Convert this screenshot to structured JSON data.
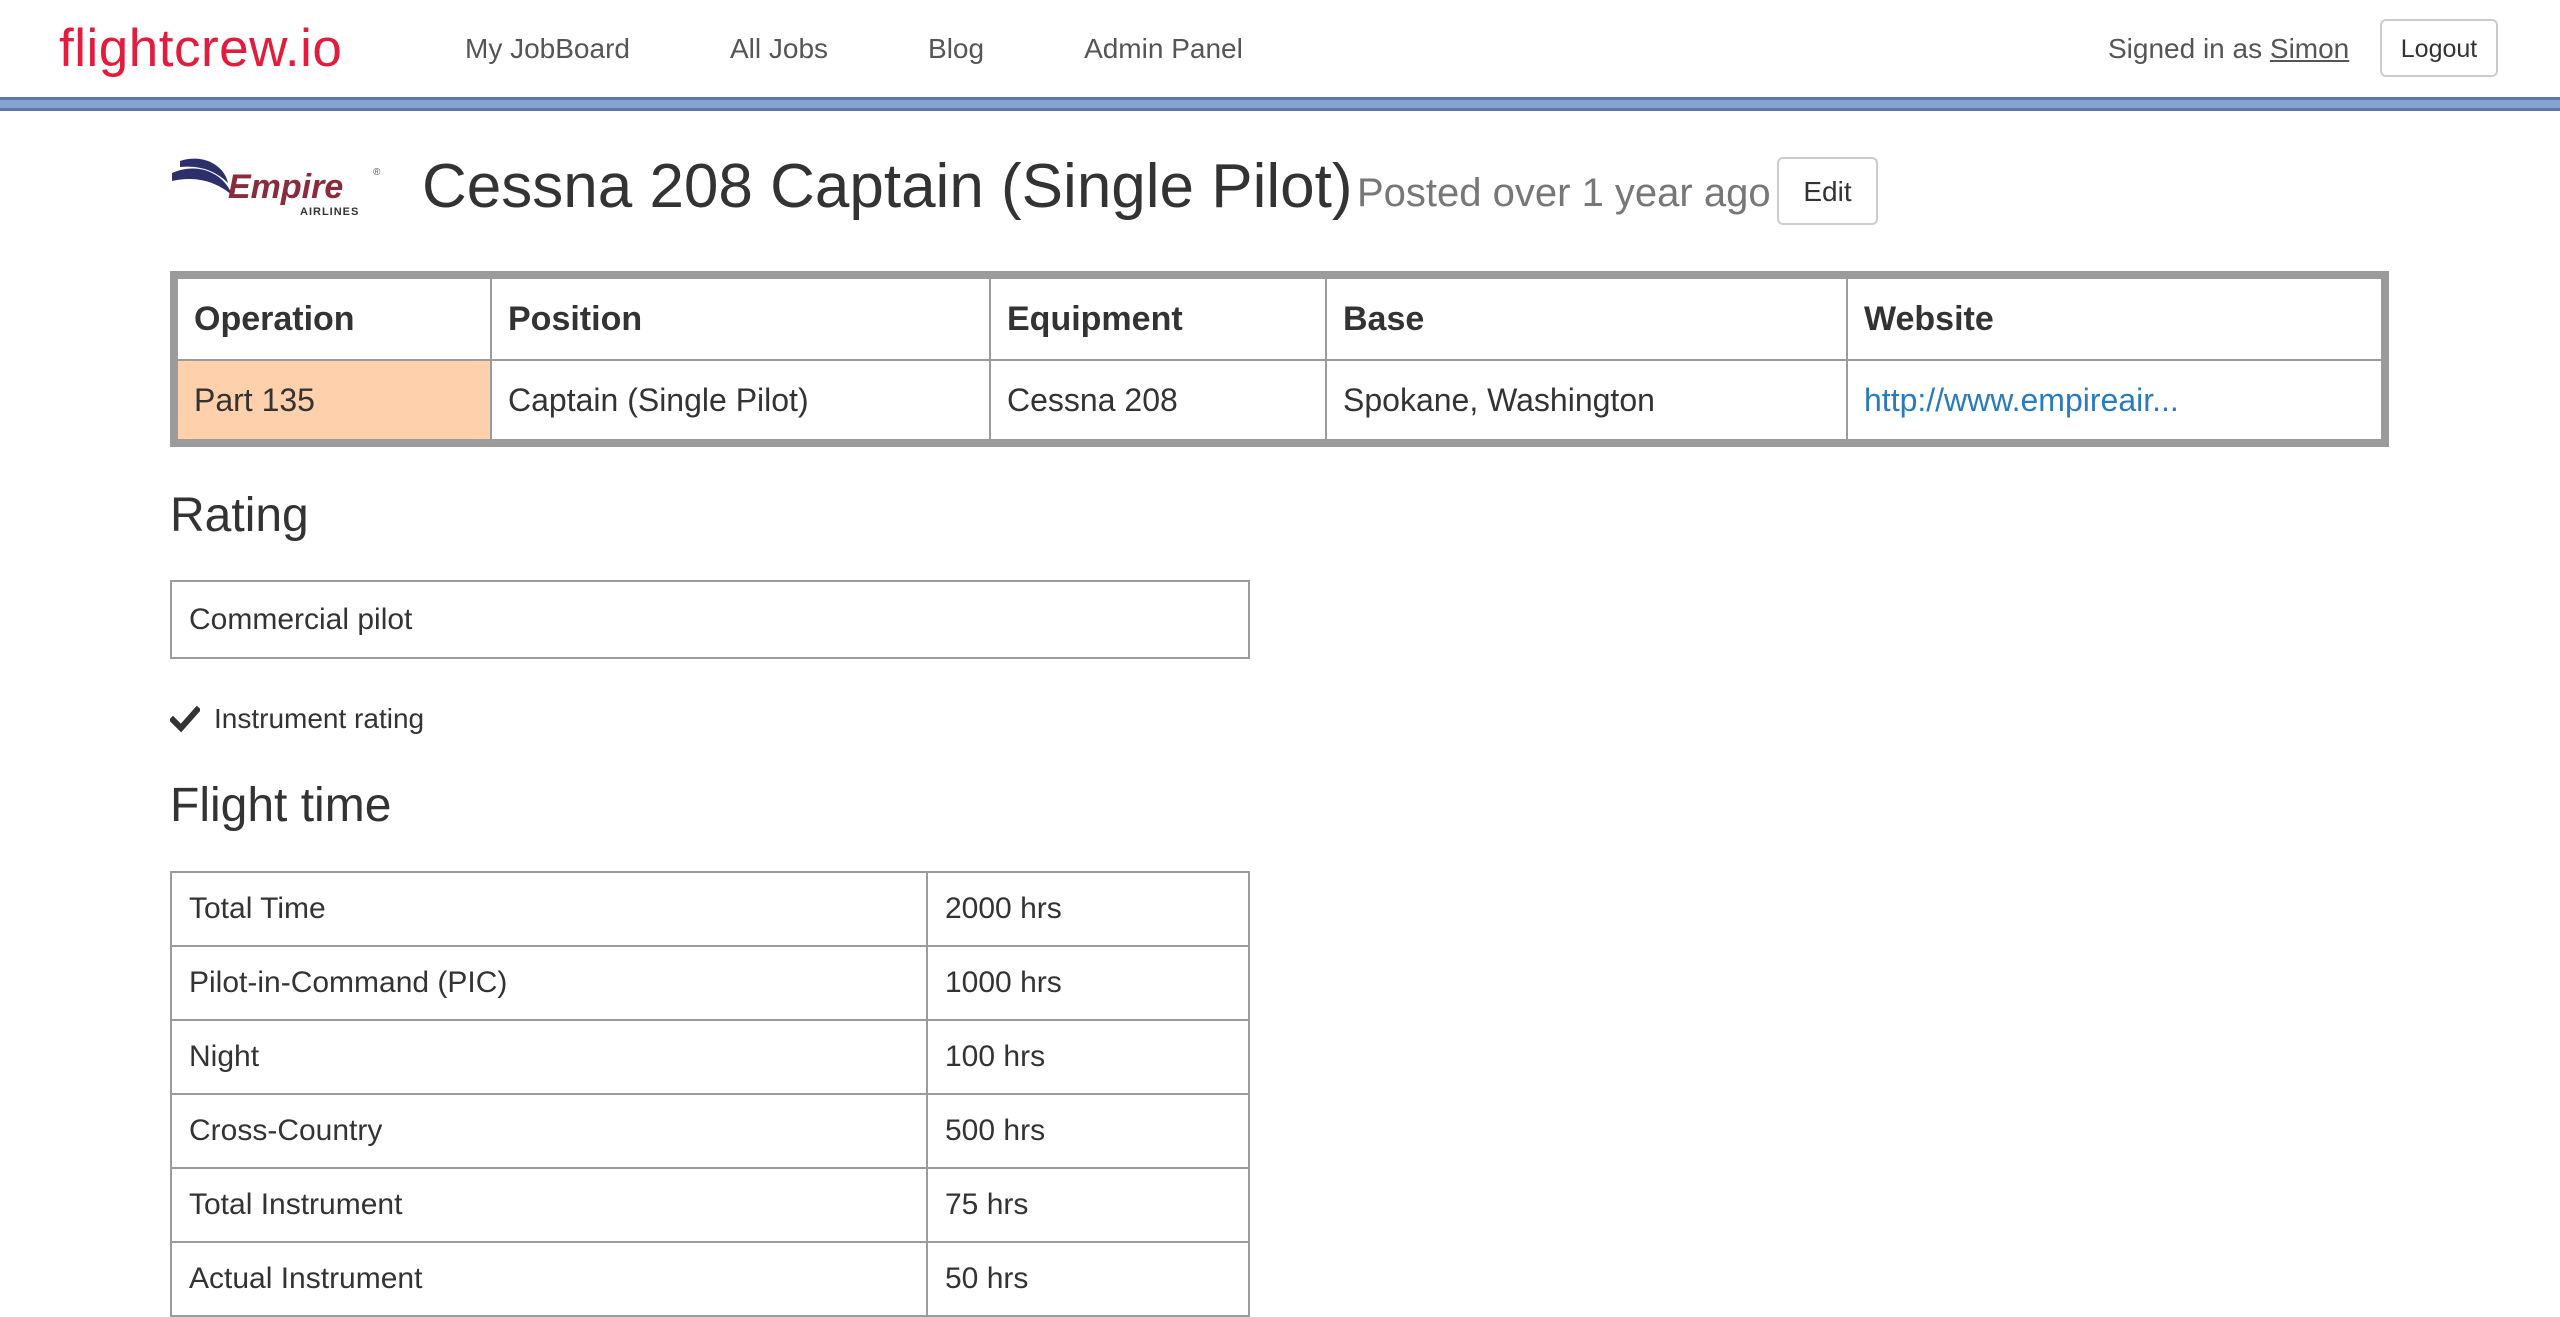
{
  "navbar": {
    "brand": "flightcrew.io",
    "links": [
      {
        "label": "My JobBoard"
      },
      {
        "label": "All Jobs"
      },
      {
        "label": "Blog"
      },
      {
        "label": "Admin Panel"
      }
    ],
    "signed_in_prefix": "Signed in as ",
    "user_name": "Simon",
    "logout_label": "Logout",
    "brand_color": "#e31c3d",
    "rule_color": "#87a3cf"
  },
  "job": {
    "company_logo": {
      "name": "Empire",
      "subtitle": "AIRLINES",
      "trademark": "®"
    },
    "title": "Cessna 208 Captain (Single Pilot)",
    "posted": "Posted over 1 year ago",
    "edit_label": "Edit"
  },
  "summary": {
    "headers": [
      "Operation",
      "Position",
      "Equipment",
      "Base",
      "Website"
    ],
    "row": {
      "operation": "Part 135",
      "position": "Captain (Single Pilot)",
      "equipment": "Cessna 208",
      "base": "Spokane, Washington",
      "website": "http://www.empireair..."
    },
    "operation_highlight_color": "#fed0ac",
    "link_color": "#2a7ac0"
  },
  "rating": {
    "heading": "Rating",
    "value": "Commercial pilot",
    "checks": [
      {
        "label": "Instrument rating",
        "icon": "checkmark-icon"
      }
    ]
  },
  "flight_time": {
    "heading": "Flight time",
    "rows": [
      {
        "label": "Total Time",
        "value": "2000 hrs"
      },
      {
        "label": "Pilot-in-Command (PIC)",
        "value": "1000 hrs"
      },
      {
        "label": "Night",
        "value": "100 hrs"
      },
      {
        "label": "Cross-Country",
        "value": "500 hrs"
      },
      {
        "label": "Total Instrument",
        "value": "75 hrs"
      },
      {
        "label": "Actual Instrument",
        "value": "50 hrs"
      }
    ]
  }
}
